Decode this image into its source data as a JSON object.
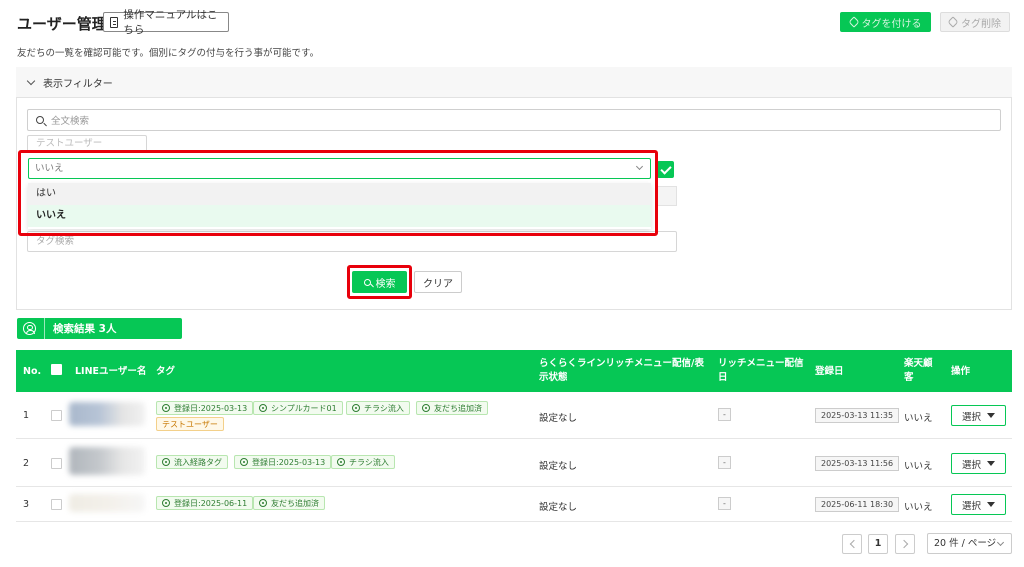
{
  "header": {
    "title": "ユーザー管理",
    "manual_button": "操作マニュアルはこちら",
    "add_tag_button": "タグを付ける",
    "remove_tag_button": "タグ削除",
    "description": "友だちの一覧を確認可能です。個別にタグの付与を行う事が可能です。"
  },
  "filter": {
    "title": "表示フィルター",
    "search_placeholder": "全文検索",
    "user_type_placeholder": "テストユーザー",
    "dropdown_value": "いいえ",
    "dropdown_options": [
      "はい",
      "いいえ"
    ],
    "tag_search_placeholder": "タグ検索",
    "search_button": "検索",
    "clear_button": "クリア"
  },
  "results": {
    "label": "検索結果 3人"
  },
  "table": {
    "headers": {
      "no": "No.",
      "line_name": "LINEユーザー名",
      "tag": "タグ",
      "richmenu_status_l1": "らくらくラインリッチメニュー配信/表",
      "richmenu_status_l2": "示状態",
      "richmenu_delivery_l1": "リッチメニュー配信",
      "richmenu_delivery_l2": "日",
      "registered": "登録日",
      "rakuten_l1": "楽天顧",
      "rakuten_l2": "客",
      "actions": "操作"
    },
    "rows": [
      {
        "no": "1",
        "tags": [
          "登録日:2025-03-13",
          "シンプルカード01",
          "チラシ流入",
          "友だち追加済"
        ],
        "orange_tag": "テストユーザー",
        "status": "設定なし",
        "delivery": "-",
        "date": "2025-03-13 11:35",
        "rakuten": "いいえ",
        "action": "選択"
      },
      {
        "no": "2",
        "tags": [
          "流入経路タグ",
          "登録日:2025-03-13",
          "チラシ流入"
        ],
        "status": "設定なし",
        "delivery": "-",
        "date": "2025-03-13 11:56",
        "rakuten": "いいえ",
        "action": "選択"
      },
      {
        "no": "3",
        "tags": [
          "登録日:2025-06-11",
          "友だち追加済"
        ],
        "status": "設定なし",
        "delivery": "-",
        "date": "2025-06-11 18:30",
        "rakuten": "いいえ",
        "action": "選択"
      }
    ]
  },
  "pagination": {
    "current_page": "1",
    "page_size": "20 件 / ページ"
  },
  "colors": {
    "accent": "#06c755",
    "highlight": "#e8000b"
  }
}
